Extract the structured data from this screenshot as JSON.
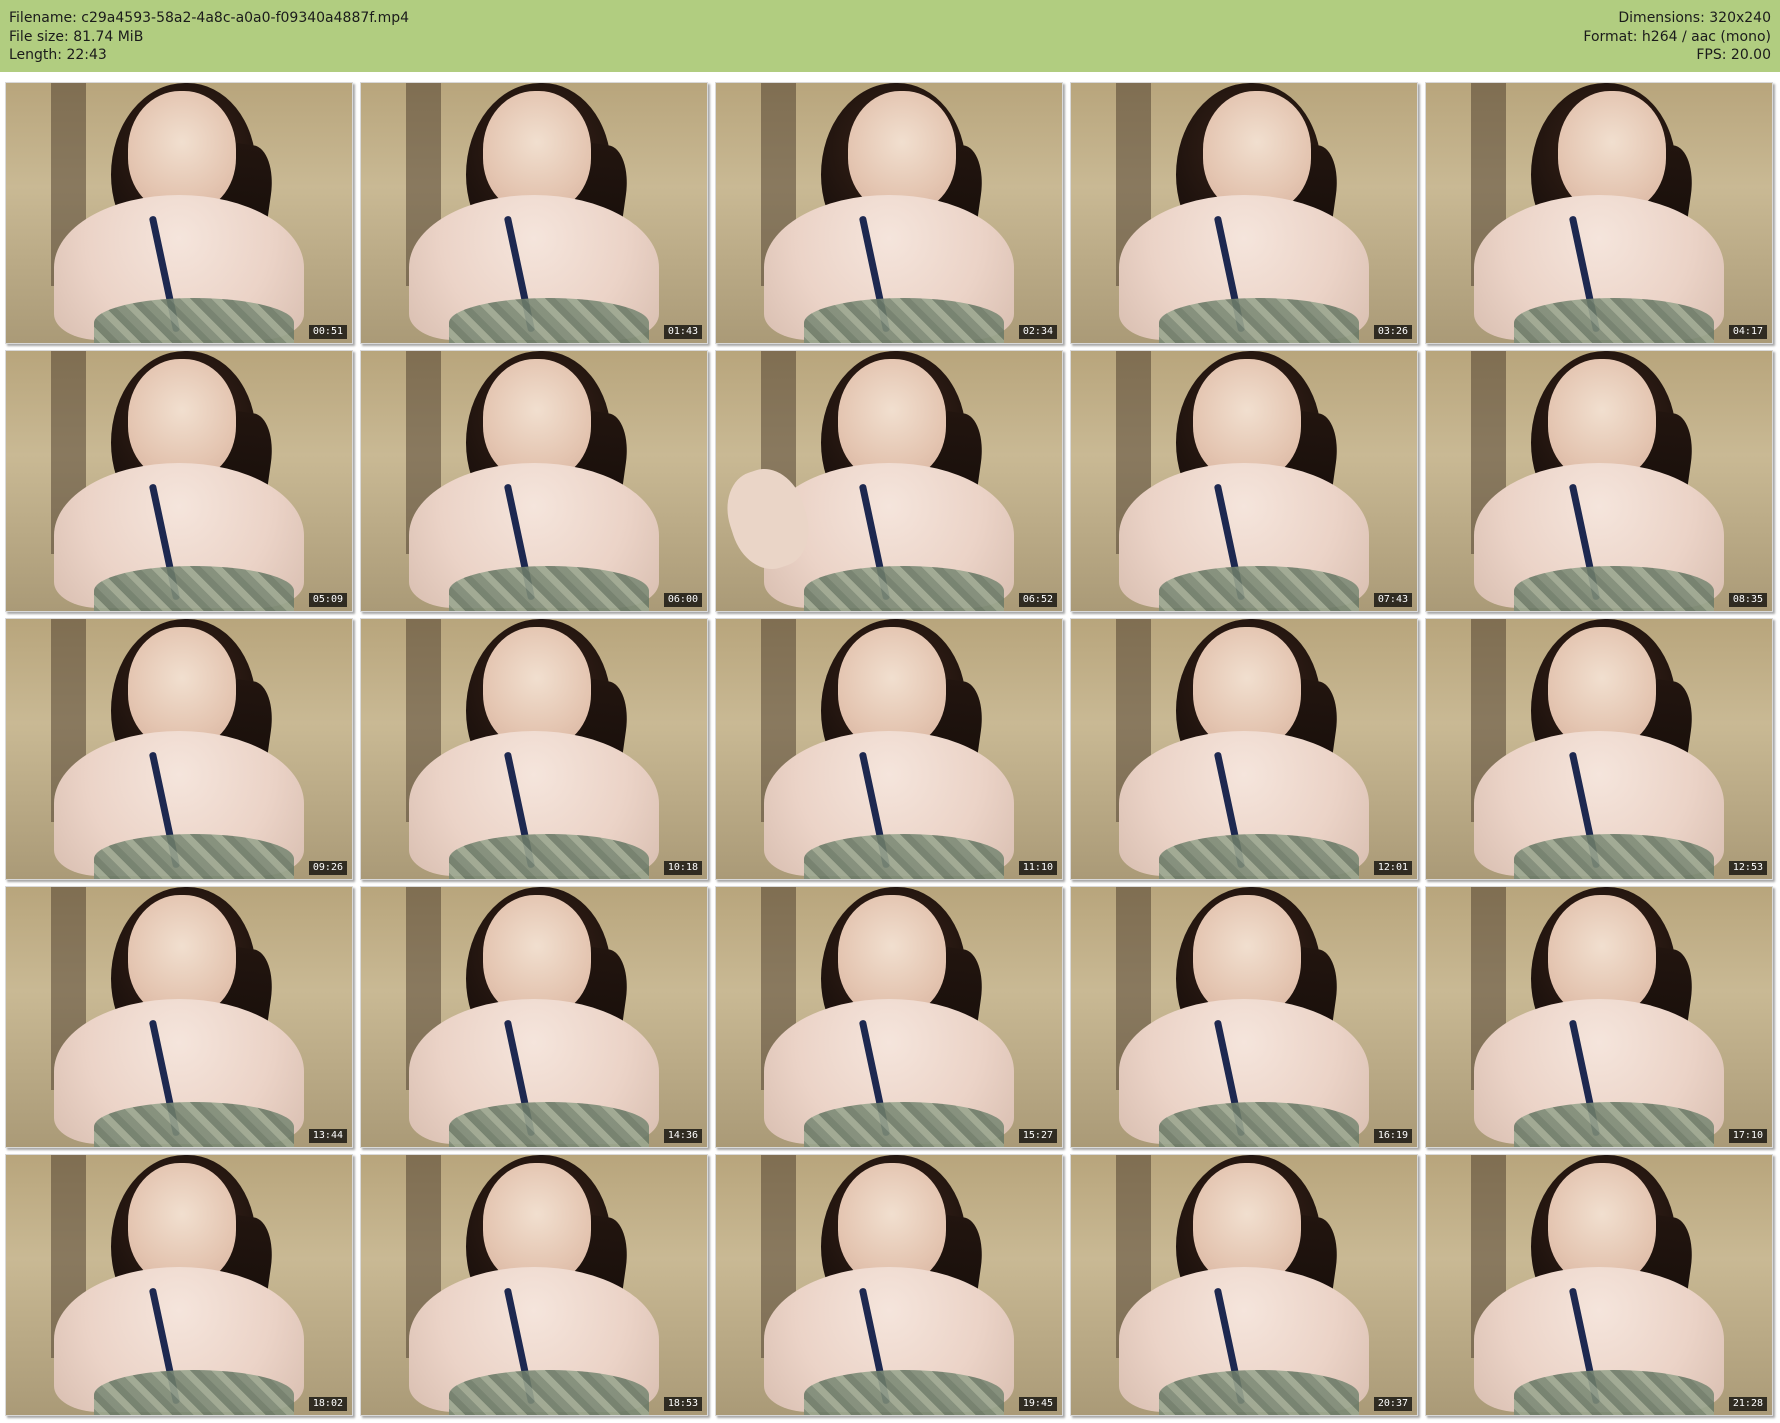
{
  "header": {
    "filename_line": "Filename: c29a4593-58a2-4a8c-a0a0-f09340a4887f.mp4",
    "filesize_line": "File size: 81.74 MiB",
    "length_line": "Length: 22:43",
    "dimensions_line": "Dimensions: 320x240",
    "format_line": "Format: h264 / aac (mono)",
    "fps_line": "FPS: 20.00"
  },
  "thumbnails": [
    {
      "time": "00:51"
    },
    {
      "time": "01:43"
    },
    {
      "time": "02:34"
    },
    {
      "time": "03:26"
    },
    {
      "time": "04:17"
    },
    {
      "time": "05:09"
    },
    {
      "time": "06:00"
    },
    {
      "time": "06:52"
    },
    {
      "time": "07:43"
    },
    {
      "time": "08:35"
    },
    {
      "time": "09:26"
    },
    {
      "time": "10:18"
    },
    {
      "time": "11:10"
    },
    {
      "time": "12:01"
    },
    {
      "time": "12:53"
    },
    {
      "time": "13:44"
    },
    {
      "time": "14:36"
    },
    {
      "time": "15:27"
    },
    {
      "time": "16:19"
    },
    {
      "time": "17:10"
    },
    {
      "time": "18:02"
    },
    {
      "time": "18:53"
    },
    {
      "time": "19:45"
    },
    {
      "time": "20:37"
    },
    {
      "time": "21:28"
    }
  ],
  "colors": {
    "header_background": "#b1cd80",
    "timestamp_background": "#000000",
    "timestamp_text": "#ffffff"
  }
}
